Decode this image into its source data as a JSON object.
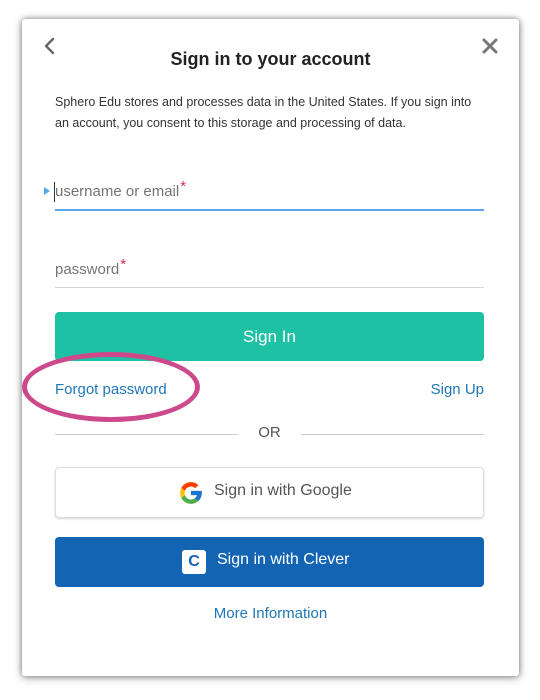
{
  "header": {
    "title": "Sign in to your account",
    "back_icon": "chevron-left-icon",
    "close_icon": "close-icon"
  },
  "notice": "Sphero Edu stores and processes data in the United States. If you sign into an account, you consent to this storage and processing of data.",
  "form": {
    "username_placeholder": "username or email",
    "password_placeholder": "password",
    "required_marker": "*",
    "signin_label": "Sign In"
  },
  "links": {
    "forgot_password": "Forgot password",
    "sign_up": "Sign Up",
    "more_information": "More Information"
  },
  "divider": {
    "text": "OR"
  },
  "social": {
    "google_label": "Sign in with Google",
    "google_icon": "google-logo-icon",
    "clever_label": "Sign in with Clever",
    "clever_icon_letter": "C"
  },
  "colors": {
    "primary_button": "#1fc1a5",
    "clever_button": "#1464b4",
    "link": "#1e76b7",
    "focus_underline": "#5ba4e6",
    "required": "#d0314a",
    "highlight_annotation": "#cc4a8c"
  }
}
